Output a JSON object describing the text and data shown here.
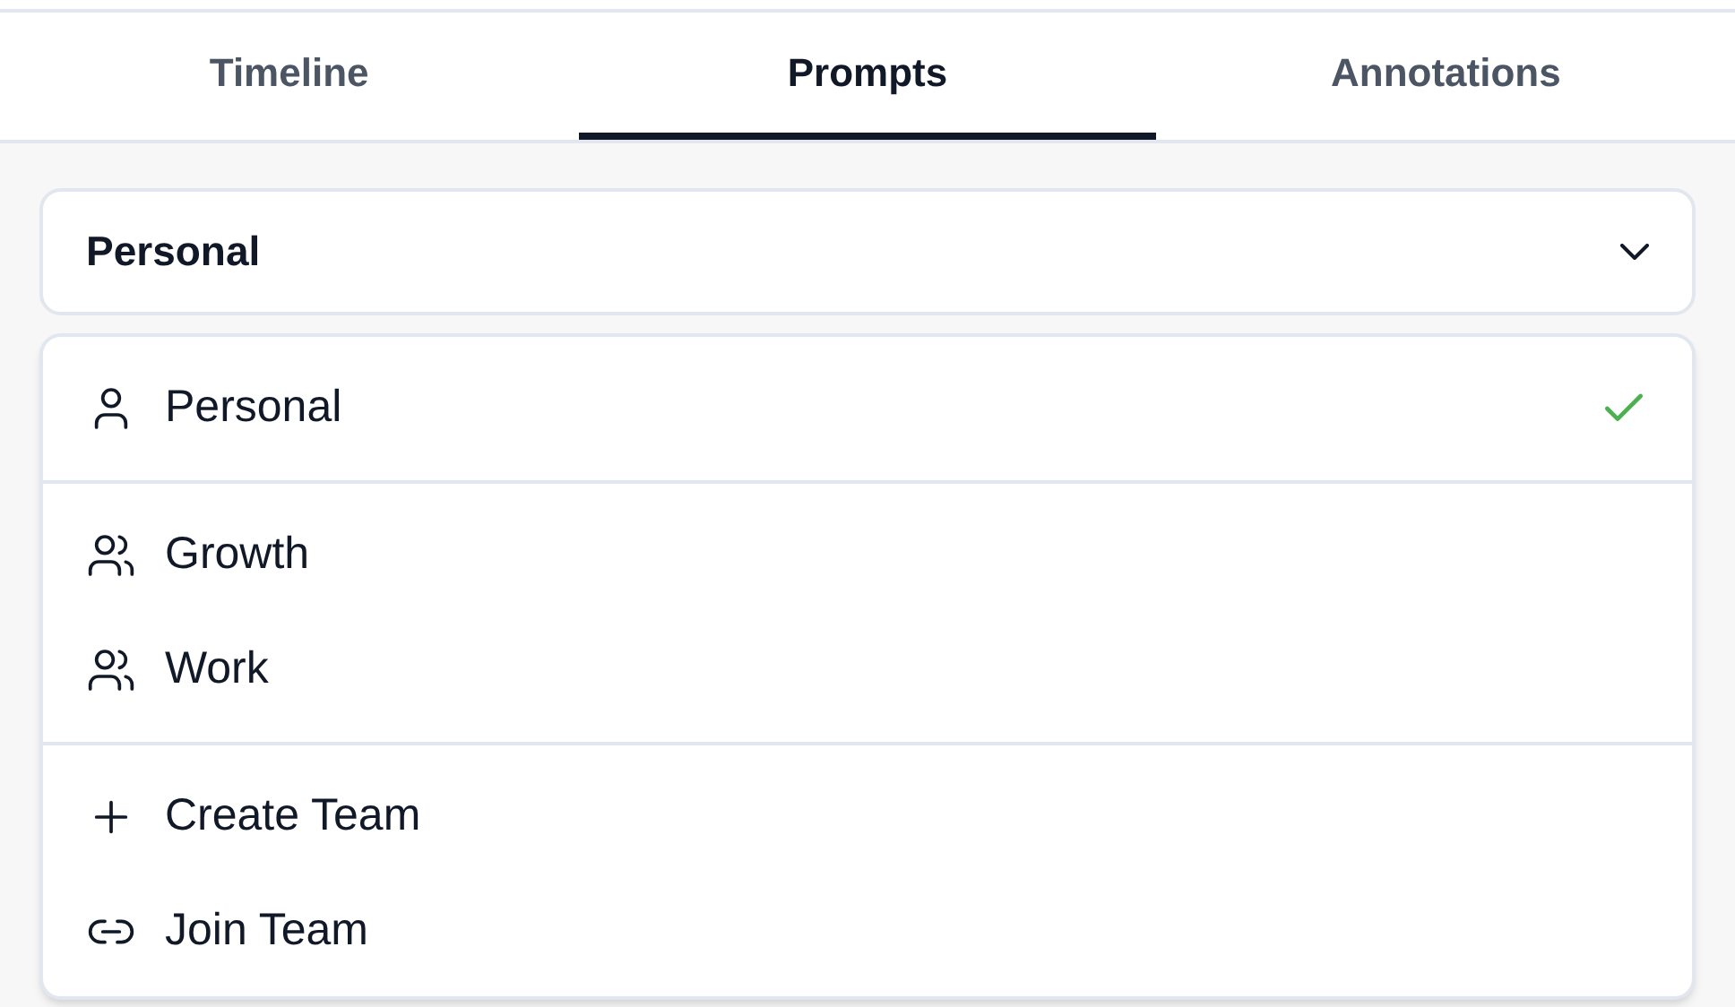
{
  "tabs": [
    {
      "label": "Timeline",
      "selected": false
    },
    {
      "label": "Prompts",
      "selected": true
    },
    {
      "label": "Annotations",
      "selected": false
    }
  ],
  "select": {
    "value": "Personal",
    "expanded": true
  },
  "menu": {
    "sections": [
      [
        {
          "label": "Personal",
          "kind": "person",
          "selected": true
        }
      ],
      [
        {
          "label": "Growth",
          "kind": "team",
          "selected": false
        },
        {
          "label": "Work",
          "kind": "team",
          "selected": false
        }
      ],
      [
        {
          "label": "Create Team",
          "kind": "create",
          "selected": false
        },
        {
          "label": "Join Team",
          "kind": "join",
          "selected": false
        }
      ]
    ]
  }
}
